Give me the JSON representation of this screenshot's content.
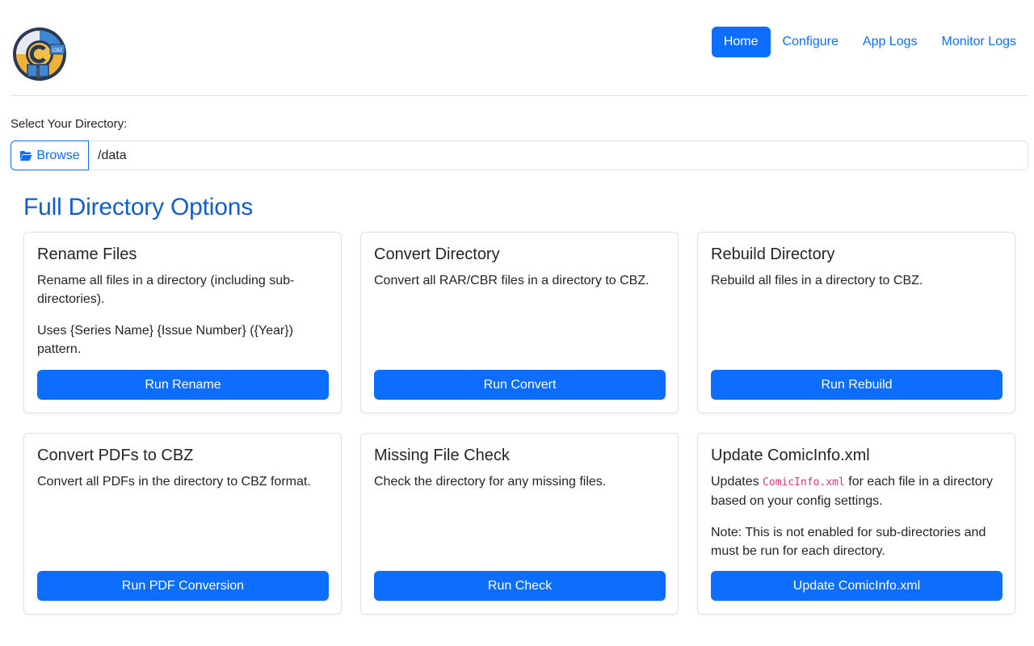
{
  "nav": {
    "items": [
      {
        "label": "Home",
        "active": true
      },
      {
        "label": "Configure",
        "active": false
      },
      {
        "label": "App Logs",
        "active": false
      },
      {
        "label": "Monitor Logs",
        "active": false
      }
    ]
  },
  "logo": {
    "badge_text": "CBZ"
  },
  "directory": {
    "label": "Select Your Directory:",
    "browse_label": "Browse",
    "browse_icon": "folder-open-icon",
    "value": "/data"
  },
  "section": {
    "title": "Full Directory Options"
  },
  "cards": [
    {
      "title": "Rename Files",
      "text": "Rename all files in a directory (including sub-directories).",
      "text2": "Uses {Series Name} {Issue Number} ({Year}) pattern.",
      "button": "Run Rename"
    },
    {
      "title": "Convert Directory",
      "text": "Convert all RAR/CBR files in a directory to CBZ.",
      "button": "Run Convert"
    },
    {
      "title": "Rebuild Directory",
      "text": "Rebuild all files in a directory to CBZ.",
      "button": "Run Rebuild"
    },
    {
      "title": "Convert PDFs to CBZ",
      "text": "Convert all PDFs in the directory to CBZ format.",
      "button": "Run PDF Conversion"
    },
    {
      "title": "Missing File Check",
      "text": "Check the directory for any missing files.",
      "button": "Run Check"
    },
    {
      "title": "Update ComicInfo.xml",
      "text_pre": "Updates ",
      "text_code": "ComicInfo.xml",
      "text_post": " for each file in a directory based on your config settings.",
      "text2": "Note: This is not enabled for sub-directories and must be run for each directory.",
      "button": "Update ComicInfo.xml"
    }
  ],
  "colors": {
    "primary": "#0d6efd",
    "title": "#0d5fcf",
    "code": "#d63384",
    "border": "#dee2e6"
  }
}
